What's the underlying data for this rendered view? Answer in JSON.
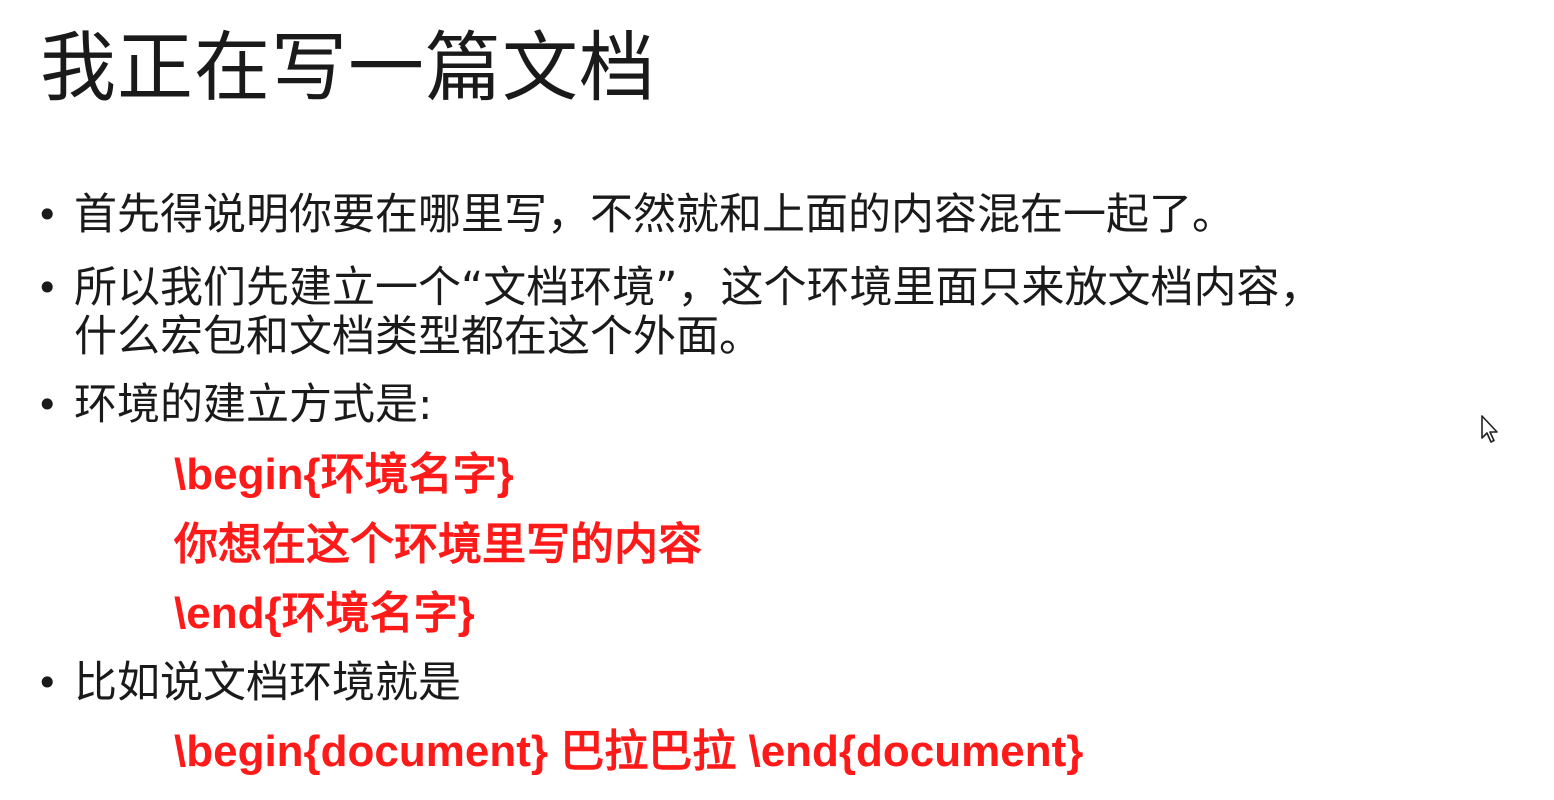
{
  "slide": {
    "title": "我正在写一篇文档",
    "bullets": [
      {
        "symbol": "•",
        "text": "首先得说明你要在哪里写，不然就和上面的内容混在一起了。"
      },
      {
        "symbol": "•",
        "text": "所以我们先建立一个“文档环境”，这个环境里面只来放文档内容，"
      },
      {
        "text": "什么宏包和文档类型都在这个外面。"
      },
      {
        "symbol": "•",
        "text": "环境的建立方式是:"
      },
      {
        "symbol": "•",
        "text": "比如说文档环境就是"
      }
    ],
    "code_lines": [
      "\\begin{环境名字}",
      "你想在这个环境里写的内容",
      "\\end{环境名字}",
      "\\begin{document} 巴拉巴拉 \\end{document}"
    ],
    "colors": {
      "text": "#1a1a1a",
      "code": "#ff1a1a",
      "background": "#ffffff"
    },
    "cursor_icon": "mouse-pointer-icon"
  }
}
